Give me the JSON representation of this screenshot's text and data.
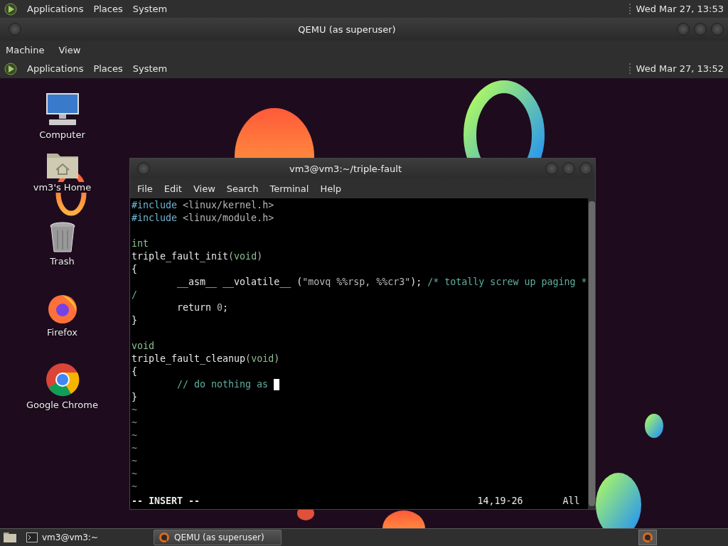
{
  "host_panel": {
    "menus": [
      "Applications",
      "Places",
      "System"
    ],
    "clock": "Wed Mar 27, 13:53"
  },
  "qemu_window": {
    "title": "QEMU (as superuser)",
    "menus": [
      "Machine",
      "View"
    ]
  },
  "guest_panel": {
    "menus": [
      "Applications",
      "Places",
      "System"
    ],
    "clock": "Wed Mar 27, 13:52"
  },
  "desktop_icons": [
    {
      "label": "Computer",
      "kind": "computer"
    },
    {
      "label": "vm3's Home",
      "kind": "home"
    },
    {
      "label": "Trash",
      "kind": "trash"
    },
    {
      "label": "Firefox",
      "kind": "firefox"
    },
    {
      "label": "Google Chrome",
      "kind": "chrome"
    }
  ],
  "terminal": {
    "title": "vm3@vm3:~/triple-fault",
    "menus": [
      "File",
      "Edit",
      "View",
      "Search",
      "Terminal",
      "Help"
    ],
    "lines": [
      {
        "segments": [
          {
            "text": "#include",
            "kind": "preproc"
          },
          {
            "text": " <linux/kernel.h>",
            "kind": "string"
          }
        ]
      },
      {
        "segments": [
          {
            "text": "#include",
            "kind": "preproc"
          },
          {
            "text": " <linux/module.h>",
            "kind": "string"
          }
        ]
      },
      {
        "blank_before": true,
        "segments": [
          {
            "text": "int",
            "kind": "type"
          }
        ]
      },
      {
        "segments": [
          {
            "text": "triple_fault_init",
            "kind": "plain"
          },
          {
            "text": "(",
            "kind": "string"
          },
          {
            "text": "void",
            "kind": "type"
          },
          {
            "text": ")",
            "kind": "string"
          }
        ]
      },
      {
        "segments": [
          {
            "text": "{",
            "kind": "plain"
          }
        ]
      },
      {
        "segments": [
          {
            "text": "        __asm__ __volatile__ (",
            "kind": "plain"
          },
          {
            "text": "\"movq %%rsp, %%cr3\"",
            "kind": "string"
          },
          {
            "text": "); ",
            "kind": "plain"
          },
          {
            "text": "/* totally screw up paging *",
            "kind": "comment"
          }
        ]
      },
      {
        "segments": [
          {
            "text": "/",
            "kind": "comment"
          }
        ]
      },
      {
        "segments": [
          {
            "text": "        return ",
            "kind": "plain"
          },
          {
            "text": "0",
            "kind": "string"
          },
          {
            "text": ";",
            "kind": "plain"
          }
        ]
      },
      {
        "segments": [
          {
            "text": "}",
            "kind": "plain"
          }
        ]
      },
      {
        "blank_before": true,
        "segments": [
          {
            "text": "void",
            "kind": "type"
          }
        ]
      },
      {
        "segments": [
          {
            "text": "triple_fault_cleanup",
            "kind": "plain"
          },
          {
            "text": "(",
            "kind": "string"
          },
          {
            "text": "void",
            "kind": "type"
          },
          {
            "text": ")",
            "kind": "string"
          }
        ]
      },
      {
        "segments": [
          {
            "text": "{",
            "kind": "plain"
          }
        ]
      },
      {
        "segments": [
          {
            "text": "        // do nothing as ",
            "kind": "comment"
          }
        ],
        "cursor": true
      },
      {
        "segments": [
          {
            "text": "}",
            "kind": "plain"
          }
        ]
      },
      {
        "segments": [
          {
            "text": "~",
            "kind": "tilde"
          }
        ]
      },
      {
        "segments": [
          {
            "text": "~",
            "kind": "tilde"
          }
        ]
      },
      {
        "segments": [
          {
            "text": "~",
            "kind": "tilde"
          }
        ]
      },
      {
        "segments": [
          {
            "text": "~",
            "kind": "tilde"
          }
        ]
      },
      {
        "segments": [
          {
            "text": "~",
            "kind": "tilde"
          }
        ]
      },
      {
        "segments": [
          {
            "text": "~",
            "kind": "tilde"
          }
        ]
      },
      {
        "segments": [
          {
            "text": "~",
            "kind": "tilde"
          }
        ]
      }
    ],
    "status": {
      "mode": "-- INSERT --",
      "position": "14,19-26",
      "scroll": "All"
    }
  },
  "taskbar": {
    "buttons": [
      {
        "label": "vm3@vm3:~",
        "kind": "terminal",
        "selected": false
      },
      {
        "label": "QEMU (as superuser)",
        "kind": "qemu",
        "selected": true
      }
    ]
  }
}
